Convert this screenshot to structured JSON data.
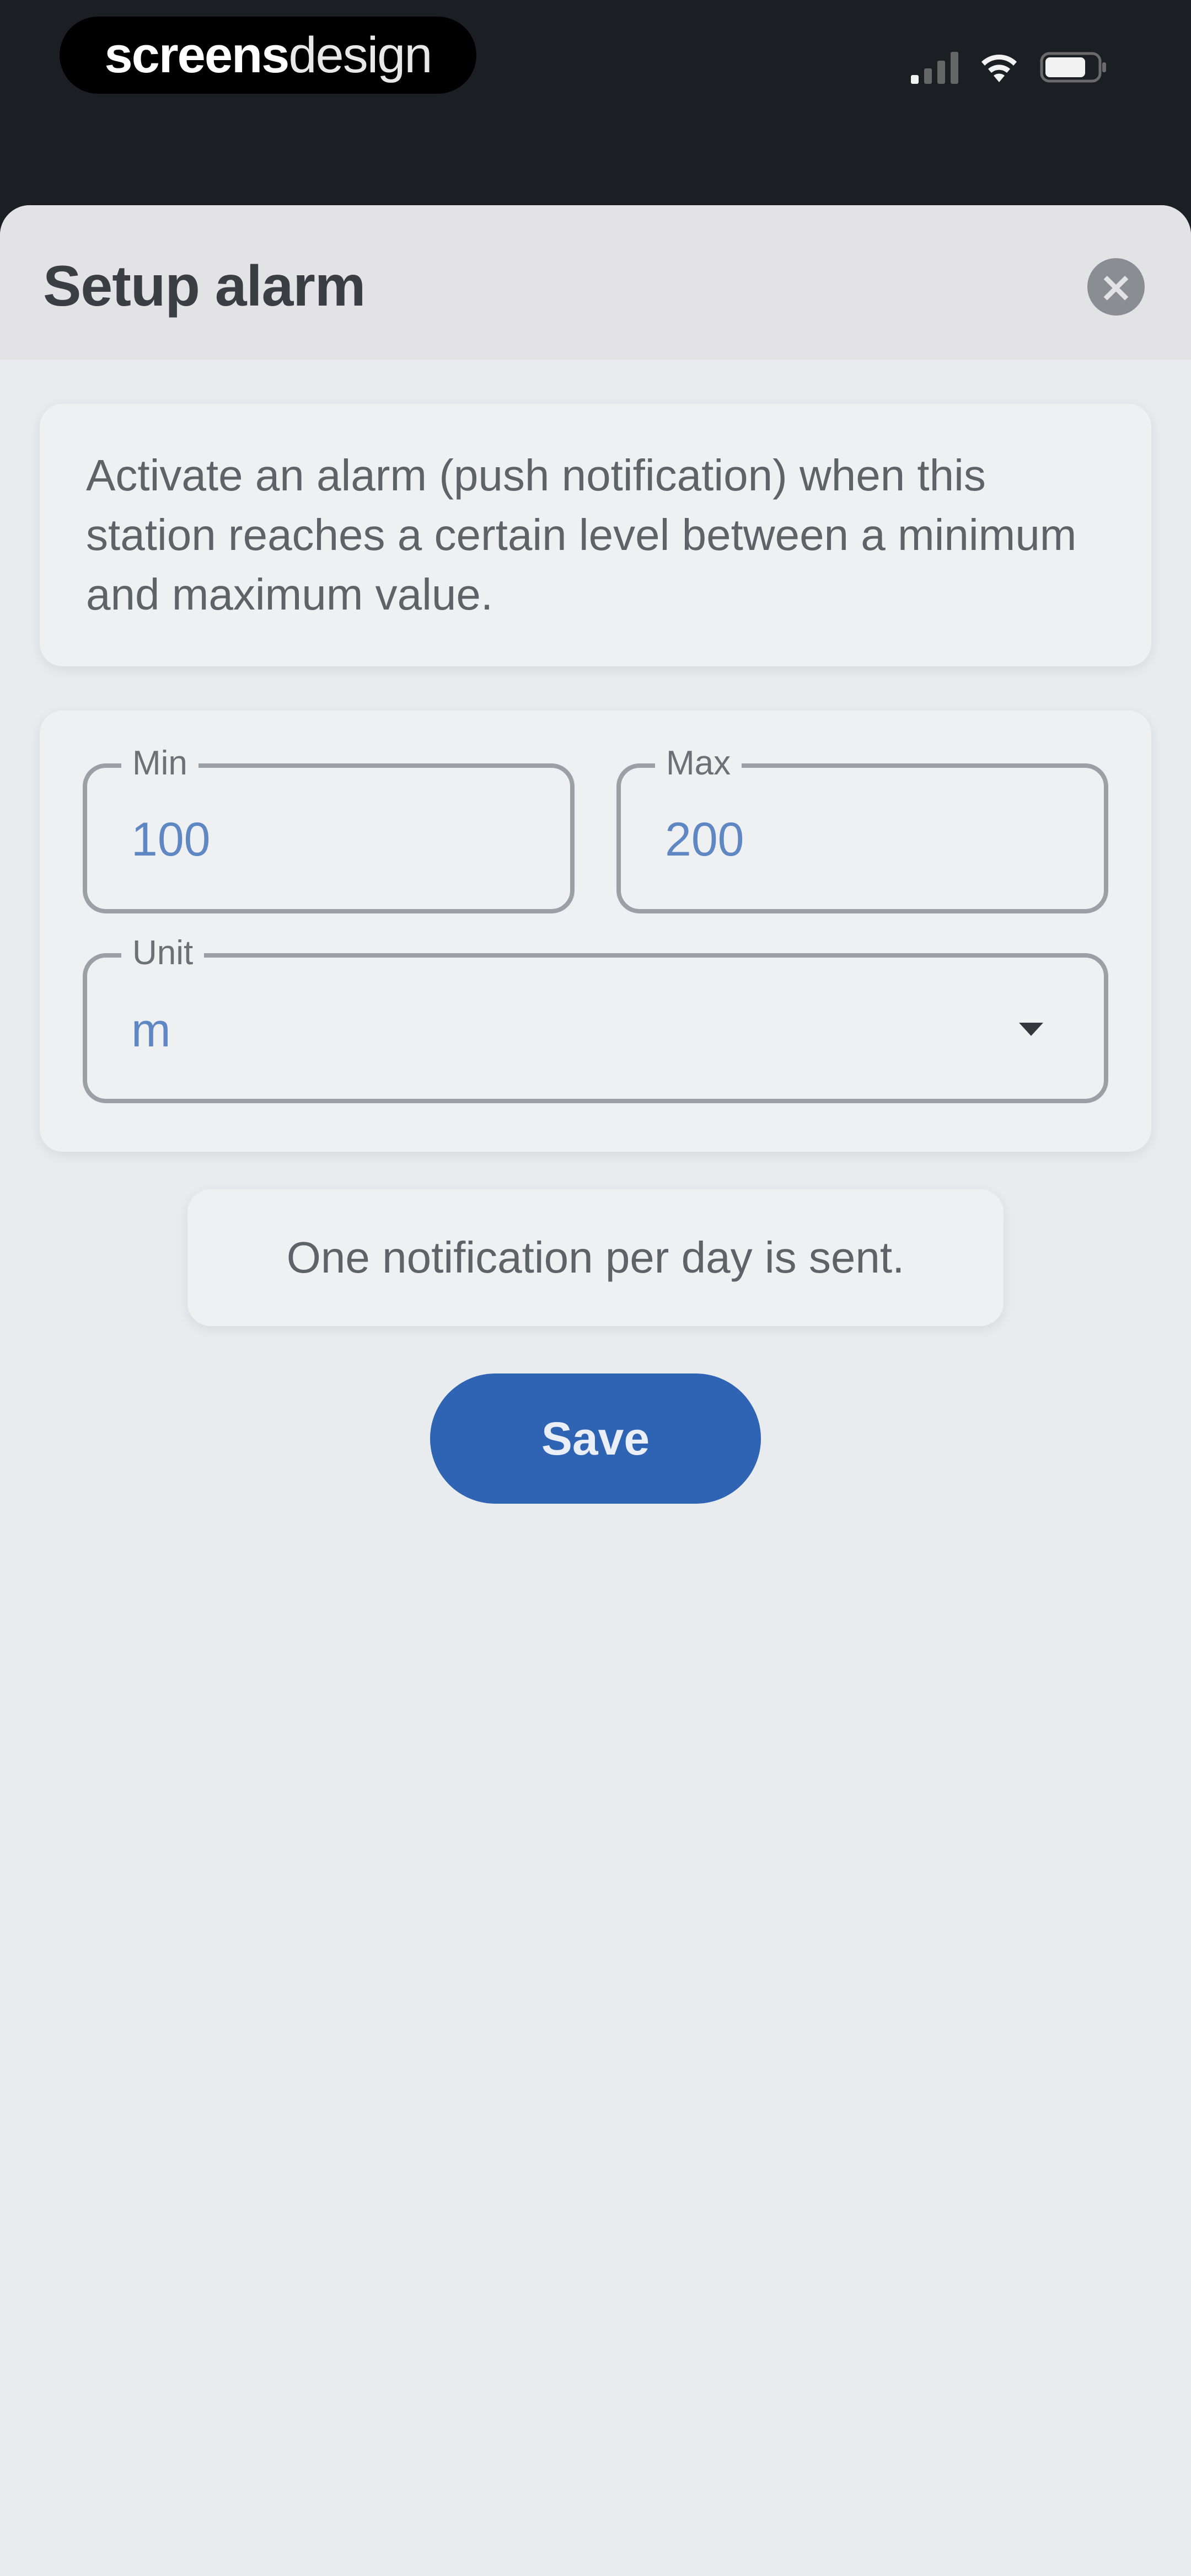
{
  "status_bar": {
    "brand_strong": "screens",
    "brand_light": "design"
  },
  "sheet": {
    "title": "Setup alarm",
    "close_icon": "close-icon",
    "intro_text": "Activate an alarm (push notification) when this station reaches a certain level between a minimum and maximum value.",
    "form": {
      "min": {
        "label": "Min",
        "value": "100"
      },
      "max": {
        "label": "Max",
        "value": "200"
      },
      "unit": {
        "label": "Unit",
        "value": "m"
      }
    },
    "note": "One notification per day is sent.",
    "save_label": "Save"
  },
  "colors": {
    "accent": "#2f63b4",
    "value_text": "#5f87c4",
    "background": "#e9ecef",
    "status_bar": "#1b1f24"
  }
}
